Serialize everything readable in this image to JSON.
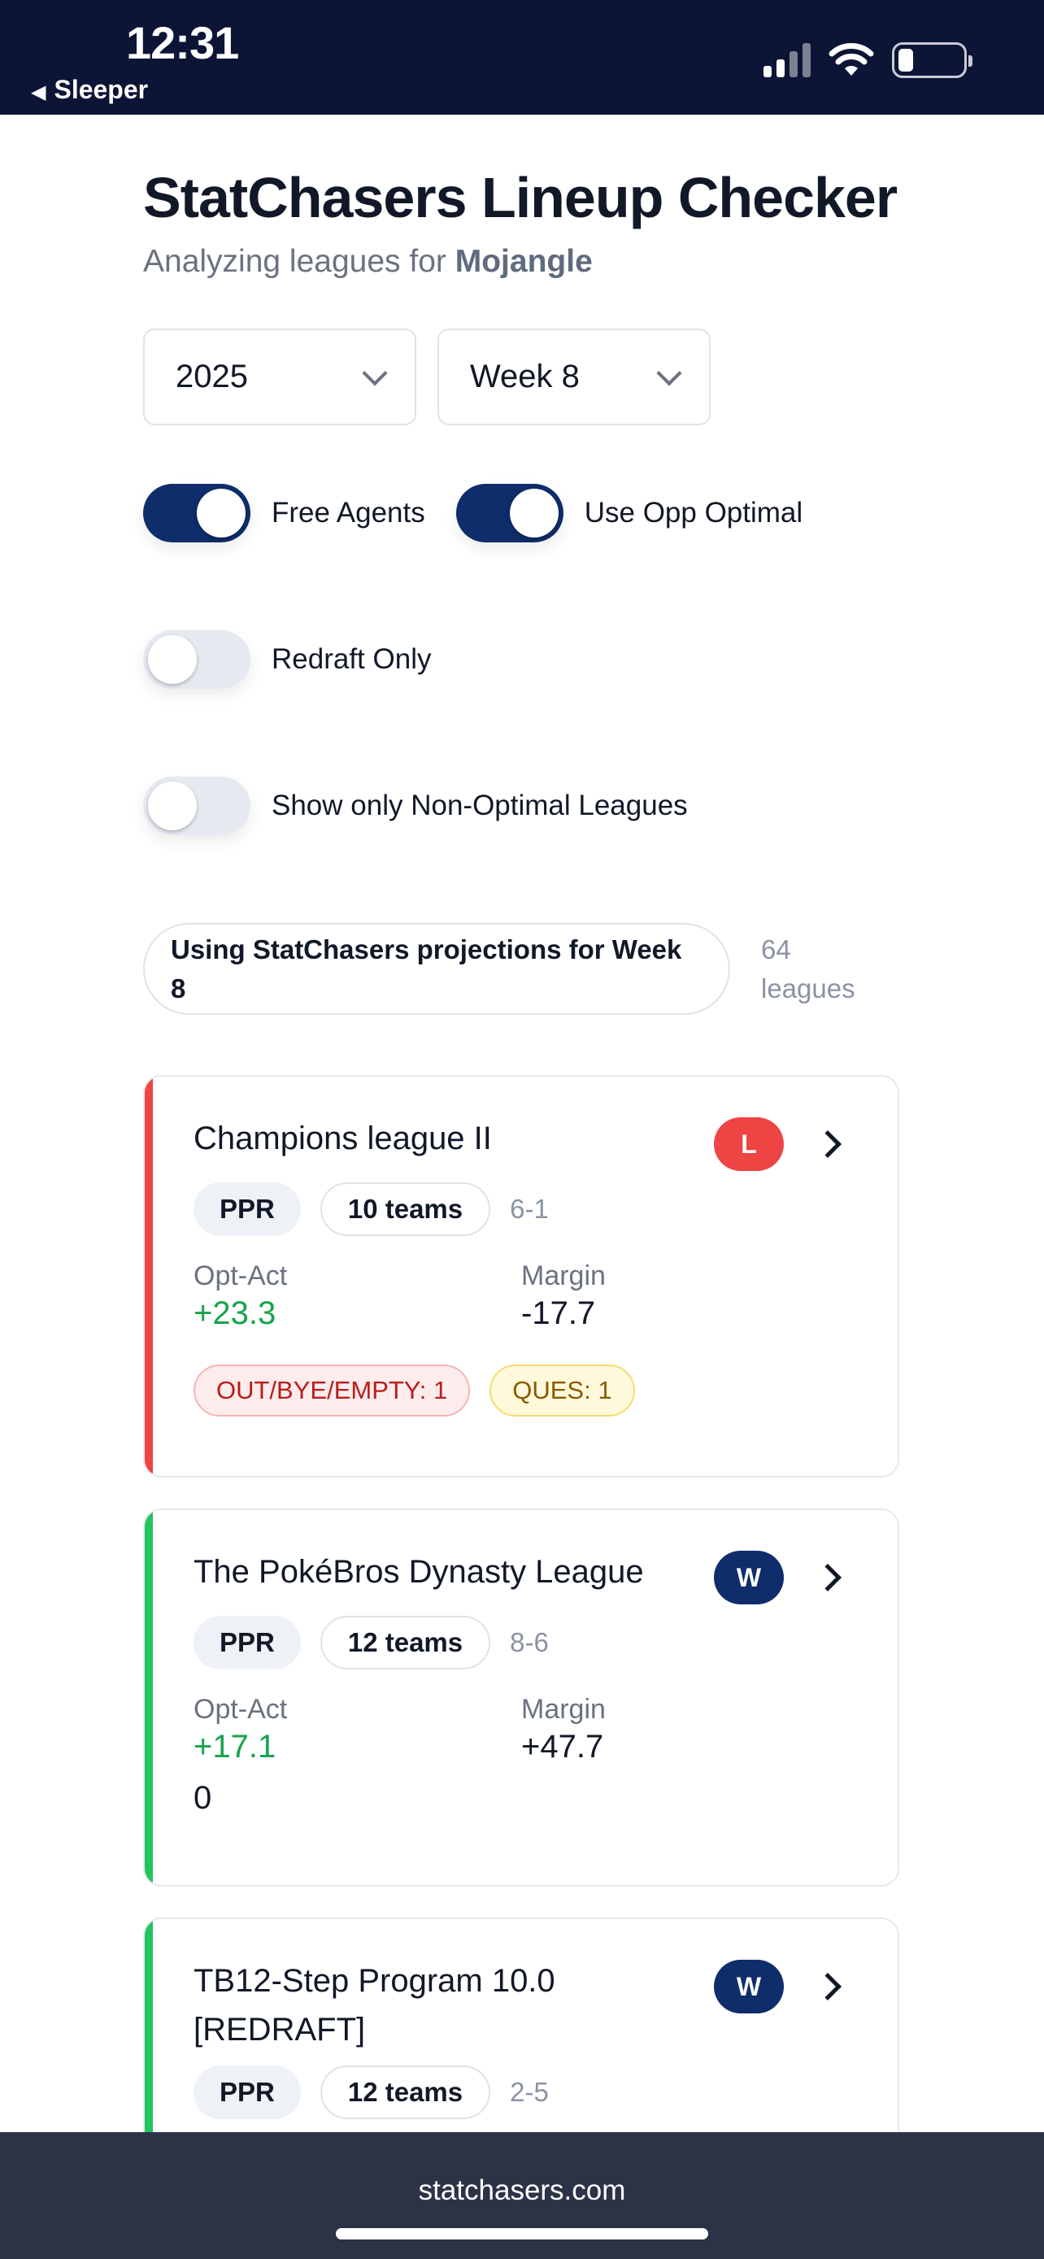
{
  "status_bar": {
    "time": "12:31",
    "back_app": "Sleeper"
  },
  "header": {
    "title": "StatChasers Lineup Checker",
    "subtitle_prefix": "Analyzing leagues for",
    "username": "Mojangle"
  },
  "filters": {
    "season": "2025",
    "week": "Week 8"
  },
  "toggles": [
    {
      "label": "Free Agents",
      "on": true
    },
    {
      "label": "Use Opp Optimal",
      "on": true
    },
    {
      "label": "Redraft Only",
      "on": false
    },
    {
      "label": "Show only Non-Optimal Leagues",
      "on": false
    }
  ],
  "info": {
    "projections_text": "Using StatChasers projections for Week 8",
    "league_count": "64 leagues"
  },
  "leagues": [
    {
      "name": "Champions league II",
      "result": "L",
      "format": "PPR",
      "teams": "10 teams",
      "record": "6-1",
      "opt_act_label": "Opt-Act",
      "opt_act": "+23.3",
      "margin_label": "Margin",
      "margin": "-17.7",
      "flags": [
        "OUT/BYE/EMPTY: 1",
        "QUES: 1"
      ]
    },
    {
      "name": "The PokéBros Dynasty League",
      "result": "W",
      "format": "PPR",
      "teams": "12 teams",
      "record": "8-6",
      "opt_act_label": "Opt-Act",
      "opt_act": "+17.1",
      "margin_label": "Margin",
      "margin": "+47.7",
      "extra": "0"
    },
    {
      "name": "TB12-Step Program 10.0 [REDRAFT]",
      "result": "W",
      "format": "PPR",
      "teams": "12 teams",
      "record": "2-5"
    }
  ],
  "footer": {
    "url": "statchasers.com"
  },
  "colors": {
    "navy": "#0f2d6b",
    "loss": "#ef4444",
    "win": "#22c55e",
    "positive": "#16a34a"
  }
}
